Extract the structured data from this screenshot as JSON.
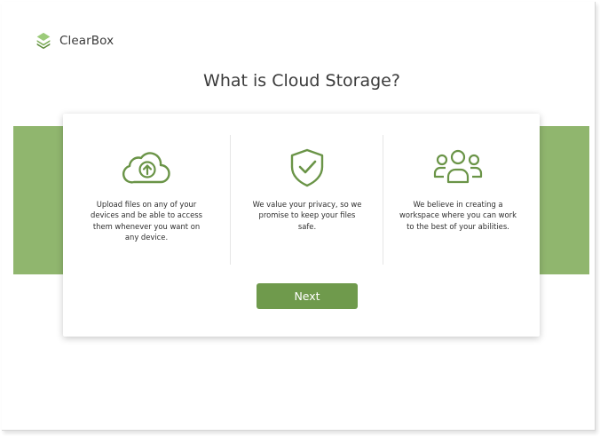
{
  "brand": {
    "name": "ClearBox",
    "logo_icon": "layered-diamond-logo-icon"
  },
  "title": "What is Cloud Storage?",
  "colors": {
    "accent": "#6f9a4c",
    "band": "#90b66e",
    "icon_stroke": "#6a9447"
  },
  "features": [
    {
      "icon": "cloud-upload-icon",
      "text": "Upload files on any of your devices and be able to access them whenever you want on any device."
    },
    {
      "icon": "shield-check-icon",
      "text": "We value your privacy, so we promise to keep your files safe."
    },
    {
      "icon": "users-group-icon",
      "text": "We believe in creating a workspace where you can work to the best of your abilities."
    }
  ],
  "next_label": "Next"
}
